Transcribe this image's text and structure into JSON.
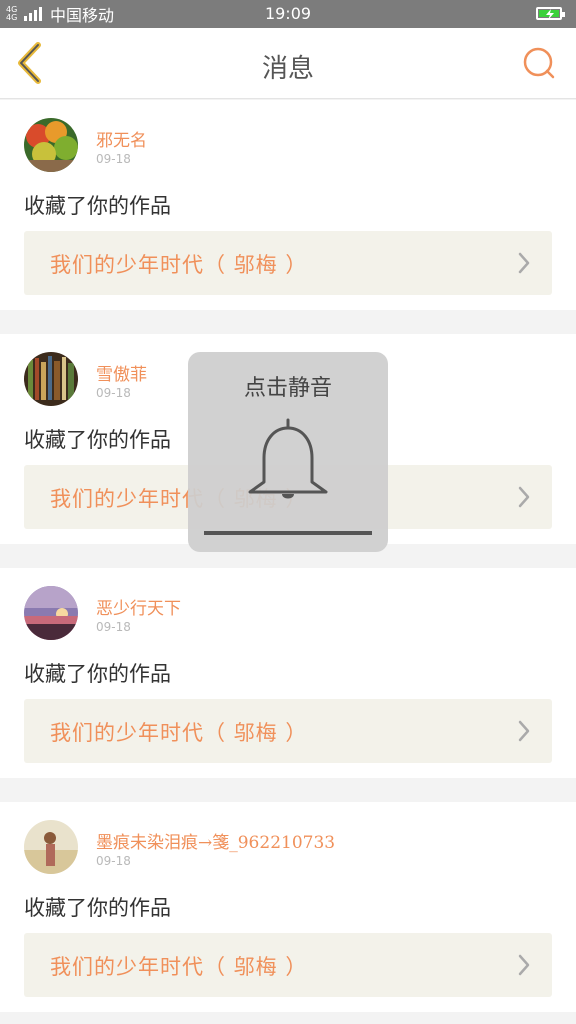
{
  "status_bar": {
    "network": "4G 4G",
    "carrier": "中国移动",
    "time": "19:09"
  },
  "header": {
    "title": "消息"
  },
  "messages": [
    {
      "name": "邪无名",
      "date": "09-18",
      "action": "收藏了你的作品",
      "work": "我们的少年时代（ 邬梅 ）"
    },
    {
      "name": "雪傲菲",
      "date": "09-18",
      "action": "收藏了你的作品",
      "work": "我们的少年时代（ 邬梅 ）"
    },
    {
      "name": "恶少行天下",
      "date": "09-18",
      "action": "收藏了你的作品",
      "work": "我们的少年时代（ 邬梅 ）"
    },
    {
      "name": "墨痕未染泪痕→箋_962210733",
      "date": "09-18",
      "action": "收藏了你的作品",
      "work": "我们的少年时代（ 邬梅 ）"
    }
  ],
  "mute_toast": {
    "label": "点击静音"
  },
  "colors": {
    "accent": "#f0905a",
    "back_icon": "#e8b93a",
    "work_bg": "#f3f2ea"
  },
  "icons": {
    "back": "chevron-left-icon",
    "search": "search-icon",
    "bell": "bell-icon",
    "chevron": "chevron-right-icon"
  }
}
